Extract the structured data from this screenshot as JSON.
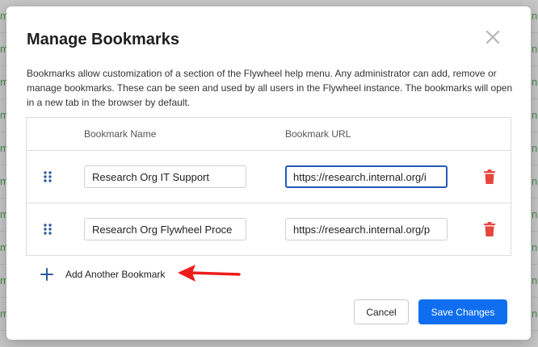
{
  "background": {
    "left_fragment": "m",
    "right_fragment": "n",
    "row_count": 10
  },
  "modal": {
    "title": "Manage Bookmarks",
    "close_icon": "close-icon",
    "description": "Bookmarks allow customization of a section of the Flywheel help menu. Any administrator can add, remove or manage bookmarks. These can be seen and used by all users in the Flywheel instance. The bookmarks will open in a new tab in the browser by default.",
    "table": {
      "headers": {
        "name": "Bookmark Name",
        "url": "Bookmark URL"
      },
      "rows": [
        {
          "name": "Research Org IT Support",
          "url": "https://research.internal.org/i",
          "focused": true
        },
        {
          "name": "Research Org Flywheel Proce",
          "url": "https://research.internal.org/p",
          "focused": false
        }
      ]
    },
    "add_label": "Add Another Bookmark",
    "buttons": {
      "cancel": "Cancel",
      "save": "Save Changes"
    }
  },
  "colors": {
    "accent": "#0f6ef0",
    "focus_border": "#2458b8",
    "delete_red": "#e5473e",
    "annotation_arrow": "#ee1c1c",
    "drag_handle": "#2d5c9c"
  }
}
